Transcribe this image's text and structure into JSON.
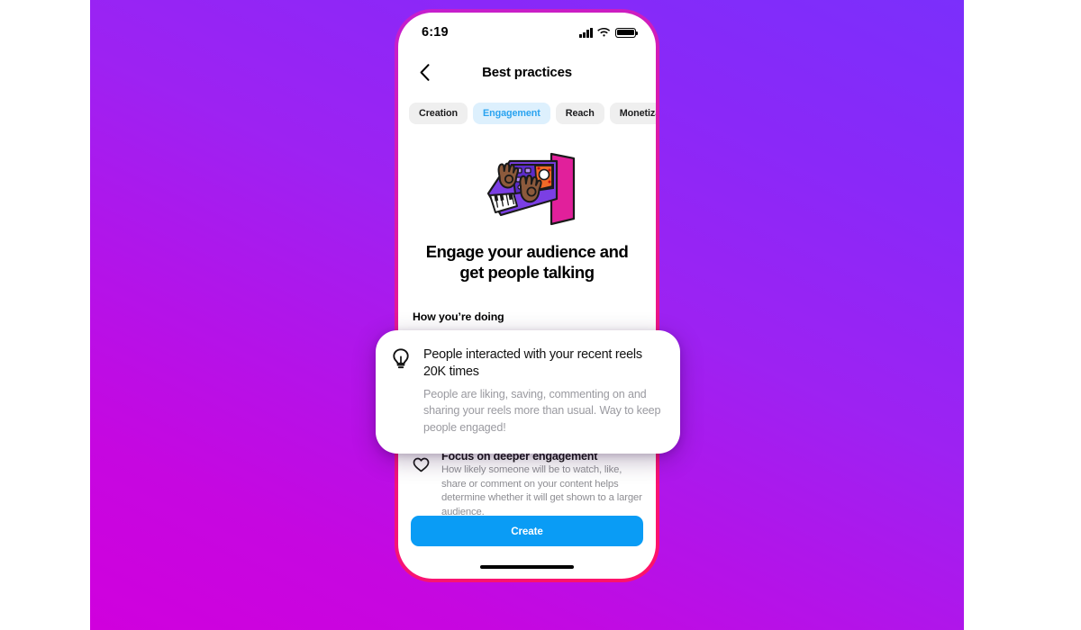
{
  "background": {
    "gradient_from": "#7B2FFB",
    "gradient_to": "#D000DD"
  },
  "phone": {
    "frame_gradient_from": "#C41FD0",
    "frame_gradient_to": "#FF1268",
    "status": {
      "time": "6:19",
      "signal_icon": "cellular-signal-icon",
      "wifi_icon": "wifi-icon",
      "battery_icon": "battery-full-icon"
    },
    "nav": {
      "back_icon": "chevron-left-icon",
      "title": "Best practices"
    },
    "tabs": [
      {
        "label": "Creation",
        "active": false
      },
      {
        "label": "Engagement",
        "active": true
      },
      {
        "label": "Reach",
        "active": false
      },
      {
        "label": "Monetization",
        "active": false
      }
    ],
    "illustration": {
      "name": "hands-playing-synthesizer-illustration",
      "colors": {
        "keyboard_body": "#7B3FE4",
        "panel": "#5B2BC9",
        "screen_pink": "#E1209B",
        "skin": "#8C5A3C",
        "keys_white": "#FFFFFF",
        "outline": "#1A1A1A"
      }
    },
    "headline": "Engage your audience and get people talking",
    "section_label": "How you’re doing",
    "list_items": [
      {
        "icon": "heart-icon",
        "title": "Focus on deeper engagement",
        "subtitle": "How likely someone will be to watch, like, share or comment on your content helps determine whether it will get shown to a larger audience."
      }
    ],
    "create_button": {
      "label": "Create",
      "color": "#0A9CF5"
    },
    "home_indicator": "home-indicator"
  },
  "popup": {
    "icon": "lightbulb-icon",
    "title": "People interacted with your recent reels 20K times",
    "subtitle": "People are liking, saving, commenting on and sharing your reels more than usual. Way to keep people engaged!"
  }
}
